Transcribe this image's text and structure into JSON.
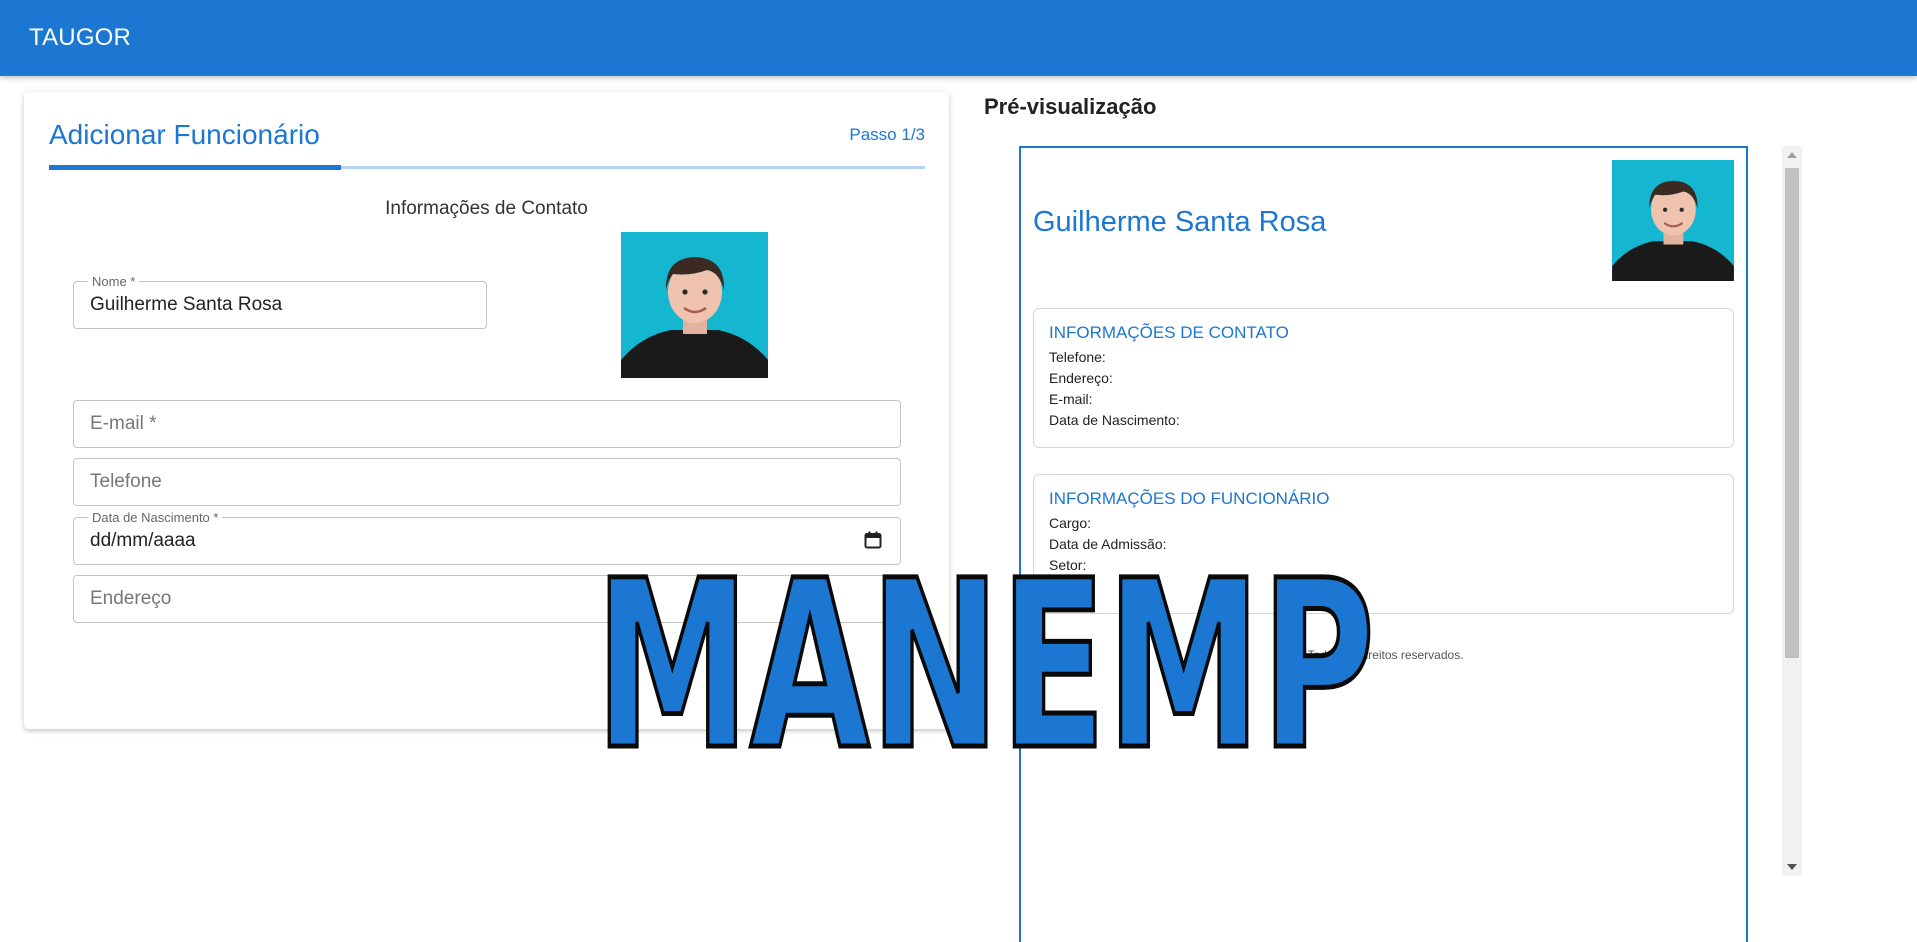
{
  "app": {
    "title": "TAUGOR"
  },
  "form": {
    "title": "Adicionar Funcionário",
    "step": "Passo 1/3",
    "progress_fraction": 0.333,
    "section_title": "Informações de Contato",
    "fields": {
      "name": {
        "label": "Nome *",
        "value": "Guilherme Santa Rosa"
      },
      "email": {
        "placeholder": "E-mail *"
      },
      "phone": {
        "placeholder": "Telefone"
      },
      "birthdate": {
        "label": "Data de Nascimento *",
        "value": "dd/mm/aaaa"
      },
      "address": {
        "placeholder": "Endereço"
      }
    }
  },
  "preview": {
    "heading": "Pré-visualização",
    "name": "Guilherme Santa Rosa",
    "contact": {
      "title": "INFORMAÇÕES DE CONTATO",
      "rows": [
        "Telefone:",
        "Endereço:",
        "E-mail:",
        "Data de Nascimento:"
      ]
    },
    "employee": {
      "title": "INFORMAÇÕES DO FUNCIONÁRIO",
      "rows": [
        "Cargo:",
        "Data de Admissão:",
        "Setor:"
      ]
    },
    "footer": "Todos os direitos reservados."
  },
  "watermark": {
    "text": "MANEMP"
  },
  "colors": {
    "primary": "#1b77d2",
    "photo_bg": "#15b6cf"
  }
}
